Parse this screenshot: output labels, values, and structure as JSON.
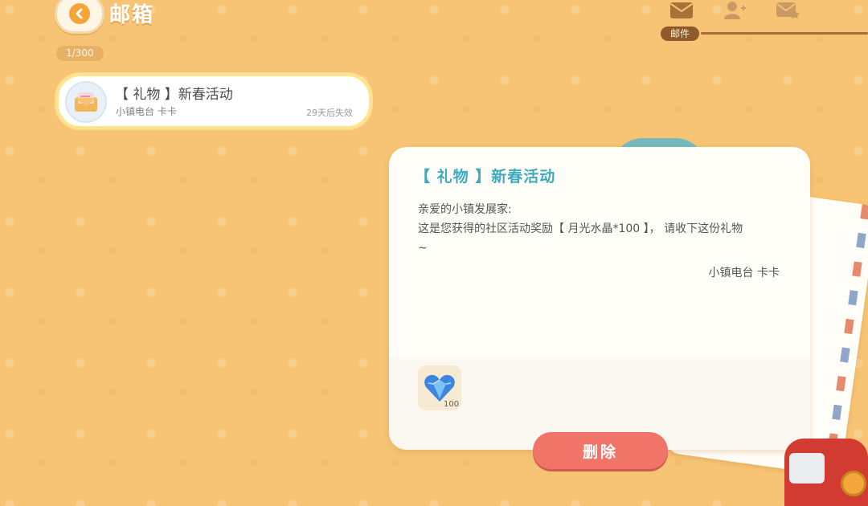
{
  "header": {
    "title": "邮箱",
    "counter": "1/300"
  },
  "tabs": {
    "active_label": "邮件",
    "icons": [
      "mail-icon",
      "add-friend-icon",
      "star-mail-icon"
    ]
  },
  "mail_list": [
    {
      "subject": "【 礼物 】新春活动",
      "sender": "小镇电台 卡卡",
      "expires": "29天后失效",
      "icon": "envelope-icon"
    }
  ],
  "letter": {
    "title": "【 礼物 】新春活动",
    "greeting": "亲爱的小镇发展家:",
    "line1": "这是您获得的社区活动奖励【 月光水晶*100 】，  请收下这份礼物",
    "line2": "~",
    "signature": "小镇电台 卡卡",
    "attachment": {
      "icon": "crystal-heart-icon",
      "count": "100"
    }
  },
  "actions": {
    "delete_label": "删除"
  },
  "colors": {
    "background": "#F6C474",
    "title_teal": "#3FA9BE",
    "delete_red": "#F07468",
    "tab_brown": "#8E5A2C"
  }
}
